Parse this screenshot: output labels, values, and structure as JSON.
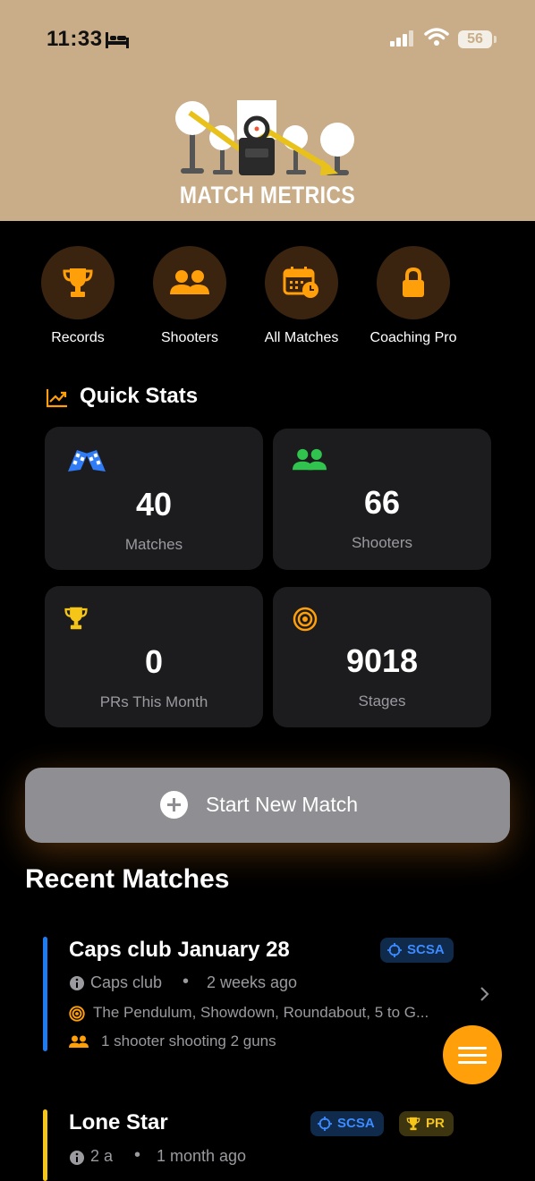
{
  "status_bar": {
    "time": "11:33",
    "battery": "56"
  },
  "app": {
    "logo_text": "MATCH METRICS"
  },
  "nav": [
    {
      "label": "Records",
      "icon": "trophy-icon"
    },
    {
      "label": "Shooters",
      "icon": "users-icon"
    },
    {
      "label": "All Matches",
      "icon": "calendar-clock-icon"
    },
    {
      "label": "Coaching Pro",
      "icon": "lock-icon"
    }
  ],
  "quick_stats": {
    "title": "Quick Stats",
    "cards": [
      {
        "value": "40",
        "label": "Matches",
        "icon": "checkered-flags-icon",
        "color": "#2f7cf6"
      },
      {
        "value": "66",
        "label": "Shooters",
        "icon": "users-icon",
        "color": "#30c44f"
      },
      {
        "value": "0",
        "label": "PRs This Month",
        "icon": "trophy-icon",
        "color": "#f5c518"
      },
      {
        "value": "9018",
        "label": "Stages",
        "icon": "target-icon",
        "color": "#ff9f0a"
      }
    ]
  },
  "start_button": {
    "label": "Start New Match"
  },
  "recent": {
    "title": "Recent Matches",
    "matches": [
      {
        "name": "Caps club January 28",
        "badges": [
          "SCSA"
        ],
        "club": "Caps club",
        "when": "2 weeks ago",
        "stages": "The Pendulum, Showdown, Roundabout, 5 to G...",
        "shooters": "1 shooter shooting 2 guns",
        "bar_color": "#1e7cf2"
      },
      {
        "name": "Lone Star",
        "badges": [
          "SCSA",
          "PR"
        ],
        "club": "2 a",
        "when": "1 month ago",
        "bar_color": "#f5c518"
      }
    ]
  },
  "colors": {
    "accent": "#ff9f0a",
    "header_bg": "#c8ad88",
    "card_bg": "#1c1c1e"
  }
}
